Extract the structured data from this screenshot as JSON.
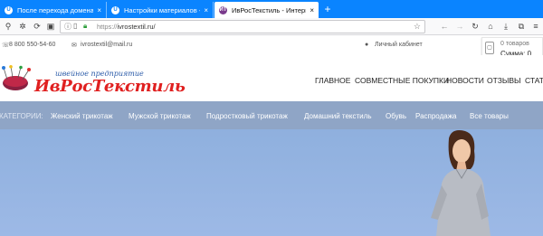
{
  "tabs": [
    {
      "title": "После перехода домена на u",
      "close": "×",
      "fav": "U"
    },
    {
      "title": "Настройки материалов - Кат",
      "close": "×",
      "fav": "U"
    },
    {
      "title": "ИвРосТекстиль - Интернет-м",
      "close": "×",
      "fav": "ИТ"
    }
  ],
  "newtab": "+",
  "url": {
    "protocol": "https://",
    "host": "ivrostextil.ru/"
  },
  "info": {
    "phone": "8 800 550-54-60",
    "email": "ivrostextil@mail.ru",
    "account": "Личный кабинет"
  },
  "cart": {
    "count": "0 товаров",
    "sum": "Сумма: 0"
  },
  "logo": {
    "subtitle": "швейное предприятие",
    "title": "ИвРосТекстиль"
  },
  "menu": [
    "ГЛАВНОЕ",
    "СОВМЕСТНЫЕ ПОКУПКИ",
    "НОВОСТИ",
    "ОТЗЫВЫ",
    "СТАТ"
  ],
  "categories": {
    "label": "КАТЕГОРИИ:",
    "items": [
      "Женский трикотаж",
      "Мужской трикотаж",
      "Подростковый трикотаж",
      "Домашний текстиль",
      "Обувь",
      "Распродажа",
      "Все товары"
    ]
  },
  "colors": {
    "firefox_blue": "#0a84ff",
    "brand_red": "#e02020",
    "category_bar": "#8fa5c6",
    "banner": "#93b3e0"
  }
}
